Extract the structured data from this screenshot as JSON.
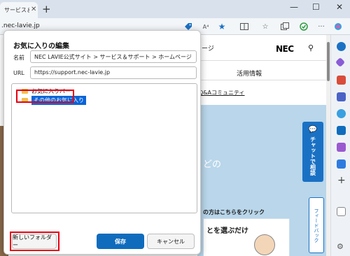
{
  "browser": {
    "tab_title": "サービス＆サ",
    "address": ".nec-lavie.jp",
    "read_aloud_label": "A⁴"
  },
  "page": {
    "logo": "NEC",
    "header_partial": "ージ",
    "nav_item": "活用情報",
    "link_text": "Q&Aコミュニティ",
    "hero_text": "どの",
    "chat_label": "チャットで相談",
    "feedback_label": "フィードバック",
    "banner_line1": "の方はこちらをクリック",
    "banner_line2": "とを選ぶだけ"
  },
  "dialog": {
    "title": "お気に入りの編集",
    "name_label": "名前",
    "name_value": "NEC LAVIE公式サイト > サービス＆サポート > ホームページ",
    "url_label": "URL",
    "url_value": "https://support.nec-lavie.jp",
    "folders": [
      {
        "label": "お気に入りバー"
      },
      {
        "label": "その他のお気に入り"
      }
    ],
    "new_folder_label": "新しいフォルダー",
    "save_label": "保存",
    "cancel_label": "キャンセル"
  },
  "colors": {
    "accent": "#0f6cbd",
    "highlight_red": "#e60012",
    "selection": "#0a64d8",
    "folder": "#f0c24b"
  }
}
